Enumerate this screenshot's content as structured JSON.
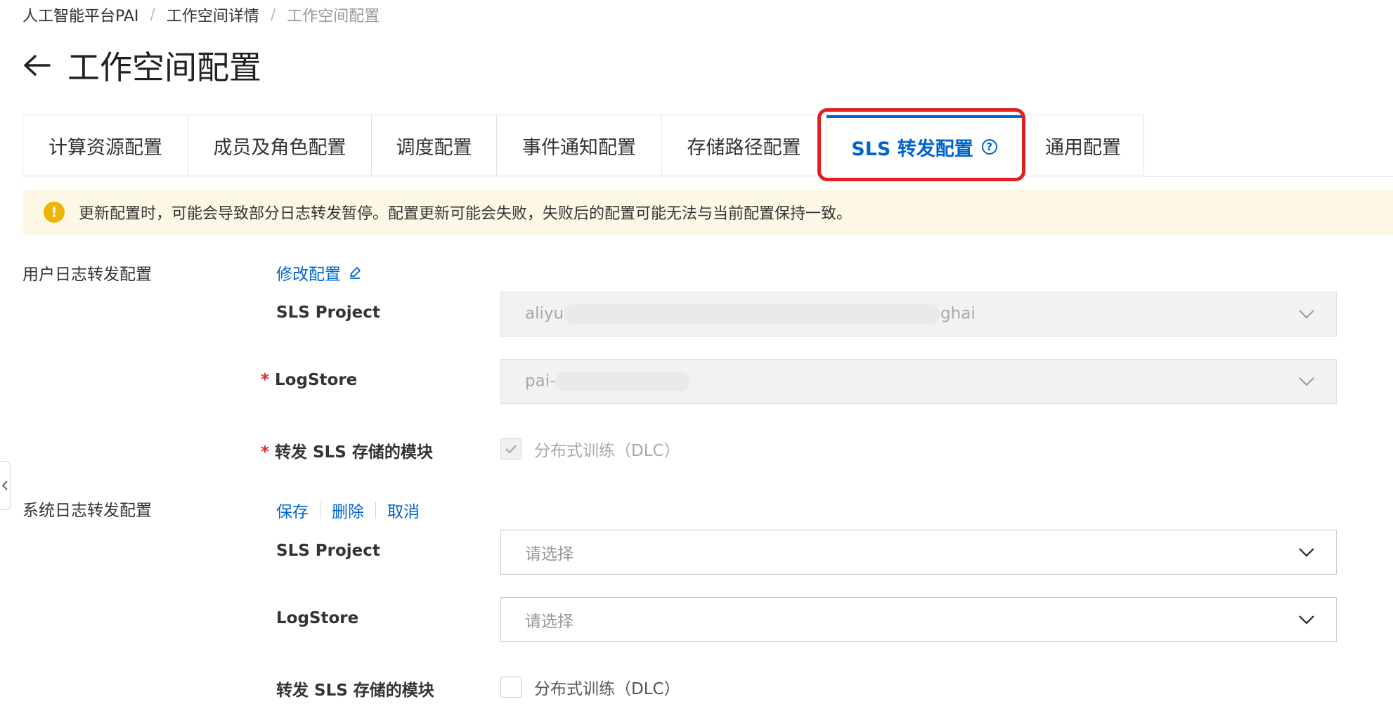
{
  "breadcrumb": [
    "人工智能平台PAI",
    "工作空间详情",
    "工作空间配置"
  ],
  "page_title": "工作空间配置",
  "tabs": [
    {
      "label": "计算资源配置"
    },
    {
      "label": "成员及角色配置"
    },
    {
      "label": "调度配置"
    },
    {
      "label": "事件通知配置"
    },
    {
      "label": "存储路径配置"
    },
    {
      "label": "SLS 转发配置",
      "active": true
    },
    {
      "label": "通用配置"
    }
  ],
  "notice": {
    "text": "更新配置时，可能会导致部分日志转发暂停。配置更新可能会失败，失败后的配置可能无法与当前配置保持一致。"
  },
  "user_log": {
    "label": "用户日志转发配置",
    "edit_link": "修改配置",
    "sls_project_label": "SLS Project",
    "sls_project_value_start": "aliyu",
    "sls_project_value_end": "ghai",
    "logstore_label": "LogStore",
    "logstore_value_start": "pai-",
    "module_label": "转发 SLS 存储的模块",
    "module_option": "分布式训练（DLC）",
    "module_checked": true
  },
  "system_log": {
    "label": "系统日志转发配置",
    "actions": [
      "保存",
      "删除",
      "取消"
    ],
    "sls_project_label": "SLS Project",
    "sls_project_placeholder": "请选择",
    "logstore_label": "LogStore",
    "logstore_placeholder": "请选择",
    "module_label": "转发 SLS 存储的模块",
    "module_option": "分布式训练（DLC）",
    "module_checked": false
  },
  "colors": {
    "accent": "#0064c8",
    "highlight": "#e02020",
    "notice_bg": "#fdf8e5",
    "warning": "#f0b400",
    "required": "#d93026"
  }
}
